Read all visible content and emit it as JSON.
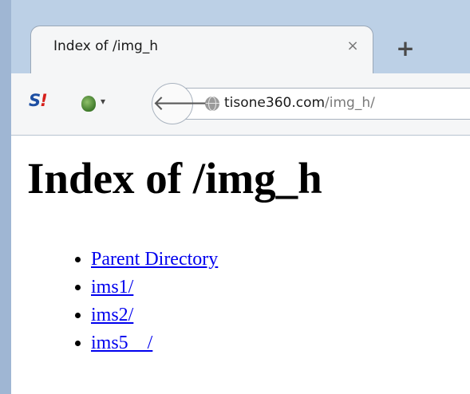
{
  "browser": {
    "tab": {
      "title": "Index of /img_h",
      "close_glyph": "×"
    },
    "new_tab_glyph": "+",
    "toolbar": {
      "addon_s_letter": "S",
      "addon_s_mark": "!",
      "onion_dropdown_glyph": "▾",
      "back_glyph": "🡐"
    },
    "url": {
      "domain": "tisone360.com",
      "path": "/img_h/"
    }
  },
  "page": {
    "title": "Index of /img_h",
    "links": [
      {
        "label": "Parent Directory"
      },
      {
        "label": "ims1/"
      },
      {
        "label": "ims2/"
      },
      {
        "label": "ims5    /"
      }
    ]
  },
  "colors": {
    "chrome_background": "#bcd0e6",
    "link": "#0000ee"
  }
}
